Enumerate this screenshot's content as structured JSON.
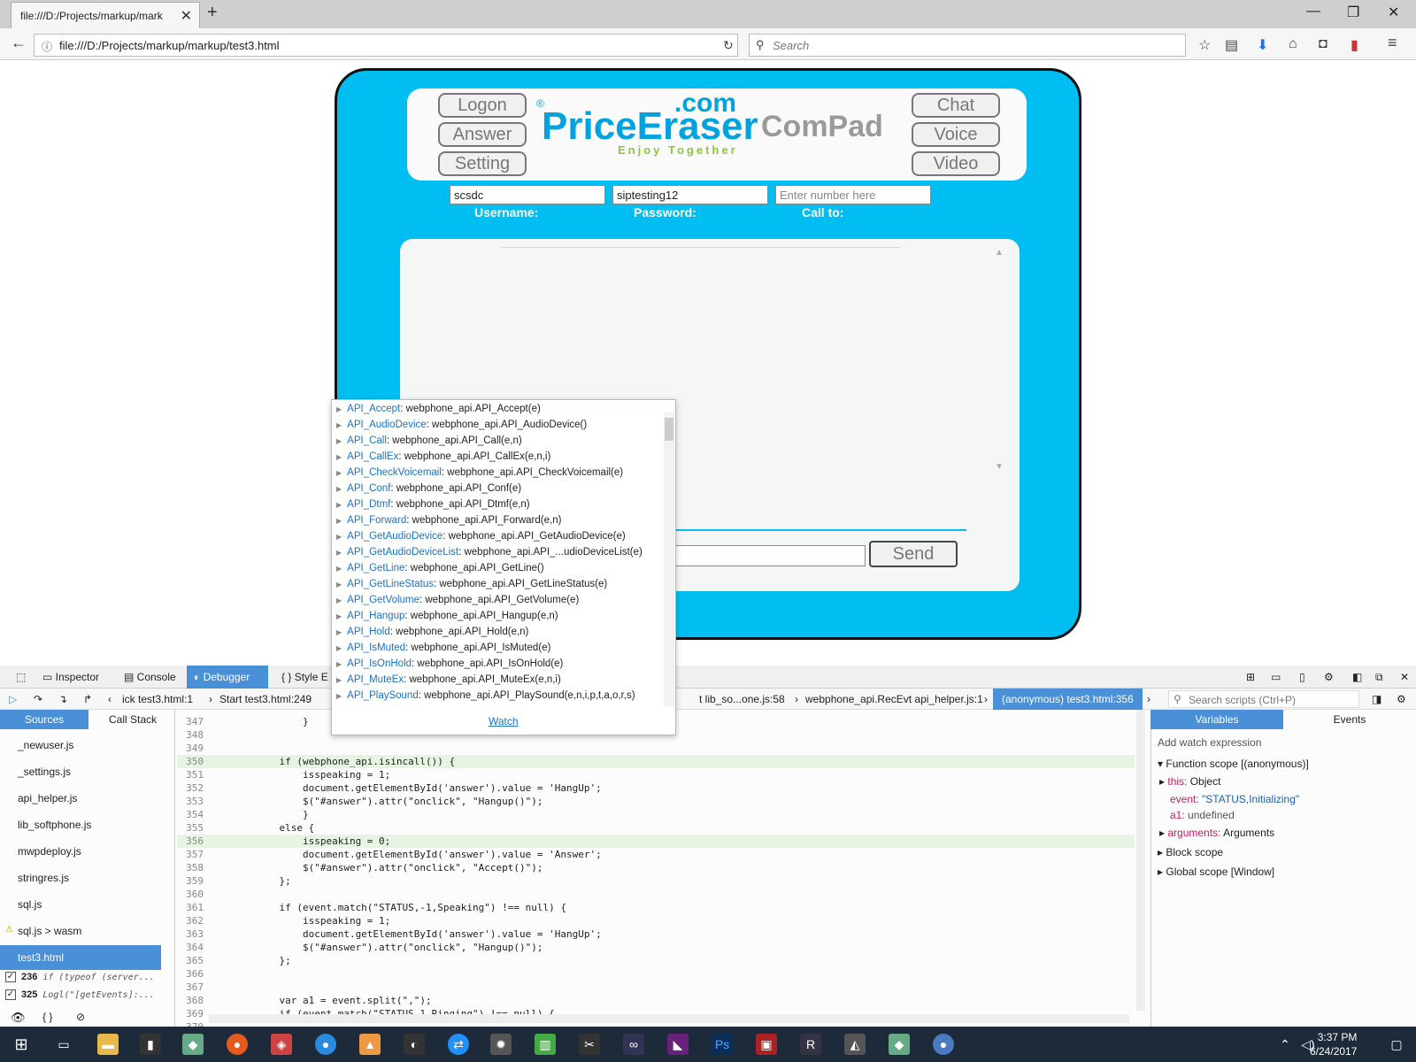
{
  "browser": {
    "tab_title": "file:///D:/Projects/markup/mark",
    "url": "file:///D:/Projects/markup/markup/test3.html",
    "search_placeholder": "Search"
  },
  "page": {
    "buttons_left": [
      "Logon",
      "Answer",
      "Setting"
    ],
    "buttons_right": [
      "Chat",
      "Voice",
      "Video"
    ],
    "logo_com": ".com",
    "logo_reg": "®",
    "logo_main": "PriceEraser",
    "logo_tagline": "Enjoy Together",
    "brand": "ComPad",
    "username_value": "scsdc",
    "password_value": "siptesting12",
    "callto_placeholder": "Enter number here",
    "label_username": "Username:",
    "label_password": "Password:",
    "label_callto": "Call to:",
    "send_label": "Send"
  },
  "devtools": {
    "tabs": [
      "Inspector",
      "Console",
      "Debugger",
      "Style E"
    ],
    "breadcrumbs": [
      "ick test3.html:1",
      "Start test3.html:249",
      "t lib_so...one.js:58",
      "webphone_api.RecEvt api_helper.js:1",
      "(anonymous) test3.html:356"
    ],
    "search_scripts": "Search scripts (Ctrl+P)",
    "left_tabs": [
      "Sources",
      "Call Stack"
    ],
    "sources": [
      "_newuser.js",
      "_settings.js",
      "api_helper.js",
      "lib_softphone.js",
      "mwpdeploy.js",
      "stringres.js",
      "sql.js",
      "sql.js > wasm",
      "test3.html"
    ],
    "breakpoints": [
      {
        "line": "236",
        "code": "if (typeof (server..."
      },
      {
        "line": "325",
        "code": "Logl(\"[getEvents]:..."
      }
    ],
    "right_tabs": [
      "Variables",
      "Events"
    ],
    "add_watch": "Add watch expression",
    "function_scope": "Function scope [(anonymous)]",
    "var_this_name": "this:",
    "var_this_value": "Object",
    "var_event_name": "event:",
    "var_event_value": "\"STATUS,Initializing\"",
    "var_a1_name": "a1:",
    "var_a1_value": "undefined",
    "var_arguments_name": "arguments:",
    "var_arguments_value": "Arguments",
    "block_scope": "Block scope",
    "global_scope": "Global scope [Window]",
    "code_lines": [
      {
        "n": "347",
        "t": "                }"
      },
      {
        "n": "348",
        "t": ""
      },
      {
        "n": "349",
        "t": ""
      },
      {
        "n": "350",
        "t": "            if (webphone_api.isincall()) {"
      },
      {
        "n": "351",
        "t": "                isspeaking = 1;"
      },
      {
        "n": "352",
        "t": "                document.getElementById('answer').value = 'HangUp';"
      },
      {
        "n": "353",
        "t": "                $(\"#answer\").attr(\"onclick\", \"Hangup()\");"
      },
      {
        "n": "354",
        "t": "                }"
      },
      {
        "n": "355",
        "t": "            else {"
      },
      {
        "n": "356",
        "t": "                isspeaking = 0;"
      },
      {
        "n": "357",
        "t": "                document.getElementById('answer').value = 'Answer';"
      },
      {
        "n": "358",
        "t": "                $(\"#answer\").attr(\"onclick\", \"Accept()\");"
      },
      {
        "n": "359",
        "t": "            };"
      },
      {
        "n": "360",
        "t": ""
      },
      {
        "n": "361",
        "t": "            if (event.match(\"STATUS,-1,Speaking\") !== null) {"
      },
      {
        "n": "362",
        "t": "                isspeaking = 1;"
      },
      {
        "n": "363",
        "t": "                document.getElementById('answer').value = 'HangUp';"
      },
      {
        "n": "364",
        "t": "                $(\"#answer\").attr(\"onclick\", \"Hangup()\");"
      },
      {
        "n": "365",
        "t": "            };"
      },
      {
        "n": "366",
        "t": ""
      },
      {
        "n": "367",
        "t": ""
      },
      {
        "n": "368",
        "t": "            var a1 = event.split(\",\");"
      },
      {
        "n": "369",
        "t": "            if (event.match(\"STATUS.1.Ringing\") !== null) {"
      },
      {
        "n": "370",
        "t": ""
      }
    ]
  },
  "autocomplete": {
    "items": [
      {
        "key": "API_Accept",
        "val": "webphone_api.API_Accept(e)"
      },
      {
        "key": "API_AudioDevice",
        "val": "webphone_api.API_AudioDevice()"
      },
      {
        "key": "API_Call",
        "val": "webphone_api.API_Call(e,n)"
      },
      {
        "key": "API_CallEx",
        "val": "webphone_api.API_CallEx(e,n,i)"
      },
      {
        "key": "API_CheckVoicemail",
        "val": "webphone_api.API_CheckVoicemail(e)"
      },
      {
        "key": "API_Conf",
        "val": "webphone_api.API_Conf(e)"
      },
      {
        "key": "API_Dtmf",
        "val": "webphone_api.API_Dtmf(e,n)"
      },
      {
        "key": "API_Forward",
        "val": "webphone_api.API_Forward(e,n)"
      },
      {
        "key": "API_GetAudioDevice",
        "val": "webphone_api.API_GetAudioDevice(e)"
      },
      {
        "key": "API_GetAudioDeviceList",
        "val": "webphone_api.API_...udioDeviceList(e)"
      },
      {
        "key": "API_GetLine",
        "val": "webphone_api.API_GetLine()"
      },
      {
        "key": "API_GetLineStatus",
        "val": "webphone_api.API_GetLineStatus(e)"
      },
      {
        "key": "API_GetVolume",
        "val": "webphone_api.API_GetVolume(e)"
      },
      {
        "key": "API_Hangup",
        "val": "webphone_api.API_Hangup(e,n)"
      },
      {
        "key": "API_Hold",
        "val": "webphone_api.API_Hold(e,n)"
      },
      {
        "key": "API_IsMuted",
        "val": "webphone_api.API_IsMuted(e)"
      },
      {
        "key": "API_IsOnHold",
        "val": "webphone_api.API_IsOnHold(e)"
      },
      {
        "key": "API_MuteEx",
        "val": "webphone_api.API_MuteEx(e,n,i)"
      },
      {
        "key": "API_PlaySound",
        "val": "webphone_api.API_PlaySound(e,n,i,p,t,a,o,r,s)"
      }
    ],
    "watch_label": "Watch"
  },
  "taskbar": {
    "time": "3:37 PM",
    "date": "6/24/2017"
  }
}
